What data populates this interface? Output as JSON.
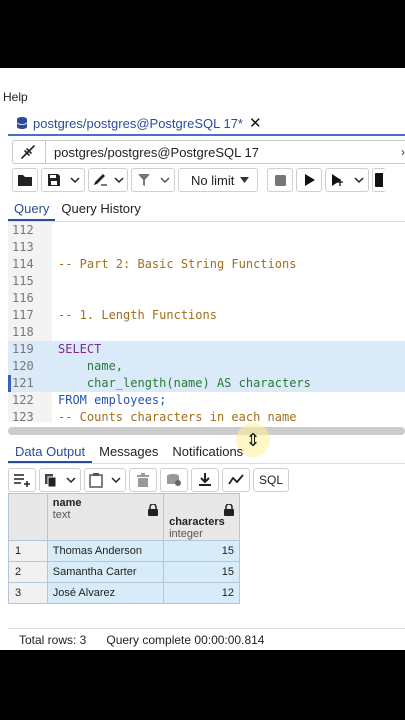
{
  "menubar": {
    "help_label": "Help"
  },
  "query_tab": {
    "title": "postgres/postgres@PostgreSQL 17*",
    "close_glyph": "✕",
    "icon": "database-icon"
  },
  "connection": {
    "label": "postgres/postgres@PostgreSQL 17",
    "icon": "connection-plug-icon",
    "chevron": "›"
  },
  "toolbar": {
    "limit_value": "No limit"
  },
  "query_tabs": [
    {
      "label": "Query",
      "active": true
    },
    {
      "label": "Query History",
      "active": false
    }
  ],
  "editor": {
    "lines": [
      {
        "num": "112",
        "text": ""
      },
      {
        "num": "113",
        "text": ""
      },
      {
        "num": "114",
        "text": "-- Part 2: Basic String Functions"
      },
      {
        "num": "115",
        "text": ""
      },
      {
        "num": "116",
        "text": ""
      },
      {
        "num": "117",
        "text": "-- 1. Length Functions"
      },
      {
        "num": "118",
        "text": ""
      },
      {
        "num": "119",
        "text": "SELECT"
      },
      {
        "num": "120",
        "text": "    name,"
      },
      {
        "num": "121",
        "text": "    char_length(name) AS characters"
      },
      {
        "num": "122",
        "text": "FROM employees;"
      },
      {
        "num": "123",
        "text": "-- Counts characters in each name"
      }
    ]
  },
  "output_tabs": [
    {
      "label": "Data Output",
      "active": true
    },
    {
      "label": "Messages",
      "active": false
    },
    {
      "label": "Notifications",
      "active": false
    }
  ],
  "output_toolbar": {
    "sql_label": "SQL"
  },
  "result_grid": {
    "columns": [
      {
        "name": "name",
        "type": "text"
      },
      {
        "name": "characters",
        "type": "integer"
      }
    ],
    "rows": [
      {
        "num": "1",
        "name": "Thomas Anderson",
        "characters": "15"
      },
      {
        "num": "2",
        "name": "Samantha Carter",
        "characters": "15"
      },
      {
        "num": "3",
        "name": "José Alvarez",
        "characters": "12"
      }
    ]
  },
  "status": {
    "total_rows": "Total rows: 3",
    "query_complete": "Query complete 00:00:00.814"
  }
}
